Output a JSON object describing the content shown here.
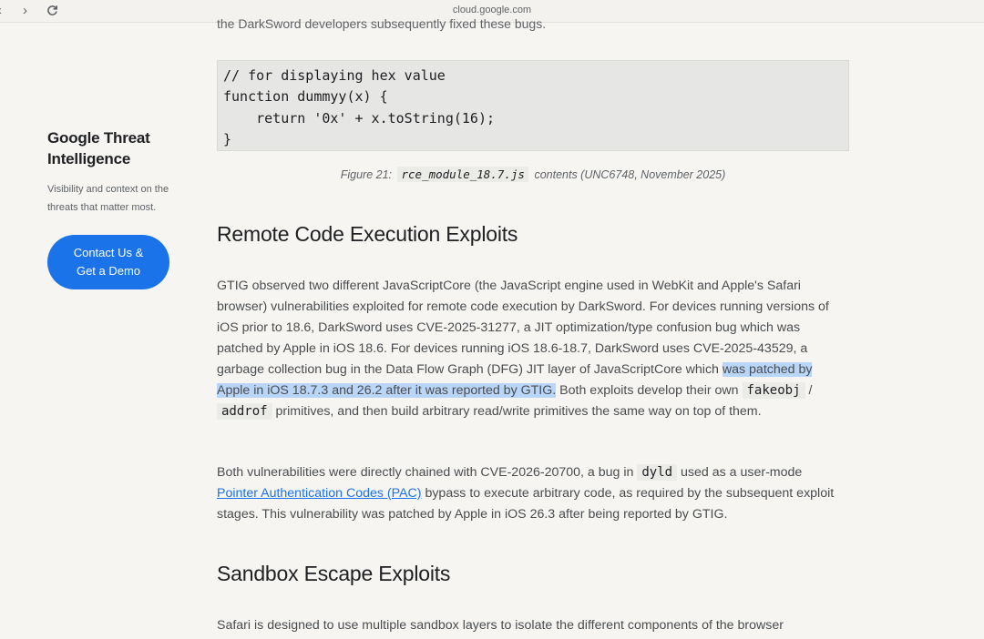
{
  "browser": {
    "url": "cloud.google.com",
    "back_glyph": "‹",
    "forward_glyph": "›"
  },
  "top_cut_text": "the DarkSword developers subsequently fixed these bugs.",
  "sidebar": {
    "title": "Google Threat Intelligence",
    "description": "Visibility and context on the threats that matter most.",
    "cta_label": "Contact Us &\nGet a Demo"
  },
  "code_block": {
    "lines": [
      "// for displaying hex value",
      "function dummyy(x) {",
      "    return '0x' + x.toString(16);",
      "}"
    ]
  },
  "caption": {
    "prefix": "Figure 21:",
    "code": "rce_module_18.7.js",
    "suffix": "contents (UNC6748, November 2025)"
  },
  "sections": {
    "rce_heading": "Remote Code Execution Exploits",
    "sandbox_heading": "Sandbox Escape Exploits"
  },
  "paragraph1": {
    "part1": "GTIG observed two different JavaScriptCore (the JavaScript engine used in WebKit and Apple's Safari browser) vulnerabilities exploited for remote code execution by DarkSword. For devices running versions of iOS prior to 18.6, DarkSword uses CVE-2025-31277, a JIT optimization/type confusion bug which was patched by Apple in iOS 18.6. For devices running iOS 18.6-18.7, DarkSword uses CVE-2025-43529, a garbage collection bug in the Data Flow Graph (DFG) JIT layer of JavaScriptCore which ",
    "highlight": "was patched by Apple in iOS 18.7.3 and 26.2 after it was reported by GTIG.",
    "part2": " Both exploits develop their own ",
    "code1": "fakeobj",
    "sep": " / ",
    "code2": "addrof",
    "part3": " primitives, and then build arbitrary read/write primitives the same way on top of them."
  },
  "paragraph2": {
    "part1": "Both vulnerabilities were directly chained with CVE-2026-20700, a bug in ",
    "code": "dyld",
    "part2": " used as a user-mode ",
    "link": "Pointer Authentication Codes (PAC)",
    "part3": " bypass to execute arbitrary code, as required by the subsequent exploit stages. This vulnerability was patched by Apple in iOS 26.3 after being reported by GTIG."
  },
  "paragraph3": "Safari is designed to use multiple sandbox layers to isolate the different components of the browser"
}
